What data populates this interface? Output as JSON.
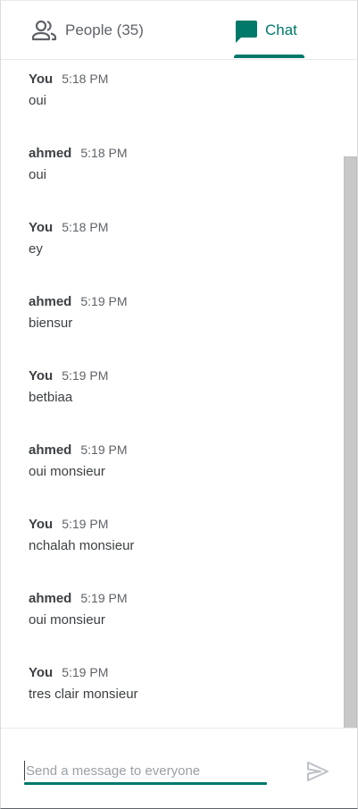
{
  "tabs": {
    "people_label": "People (35)",
    "chat_label": "Chat",
    "active": "chat",
    "accent": "#00796b"
  },
  "messages": [
    {
      "sender": "You",
      "time": "5:18 PM",
      "text": "oui"
    },
    {
      "sender": "ahmed",
      "time": "5:18 PM",
      "text": "oui"
    },
    {
      "sender": "You",
      "time": "5:18 PM",
      "text": "ey"
    },
    {
      "sender": "ahmed",
      "time": "5:19 PM",
      "text": "biensur"
    },
    {
      "sender": "You",
      "time": "5:19 PM",
      "text": "betbiaa"
    },
    {
      "sender": "ahmed",
      "time": "5:19 PM",
      "text": "oui monsieur"
    },
    {
      "sender": "You",
      "time": "5:19 PM",
      "text": "nchalah monsieur"
    },
    {
      "sender": "ahmed",
      "time": "5:19 PM",
      "text": "oui monsieur"
    },
    {
      "sender": "You",
      "time": "5:19 PM",
      "text": "tres clair monsieur"
    }
  ],
  "composer": {
    "placeholder": "Send a message to everyone",
    "value": "",
    "send_icon": "send-icon"
  },
  "icons": {
    "people": "people-icon",
    "chat": "chat-icon"
  }
}
